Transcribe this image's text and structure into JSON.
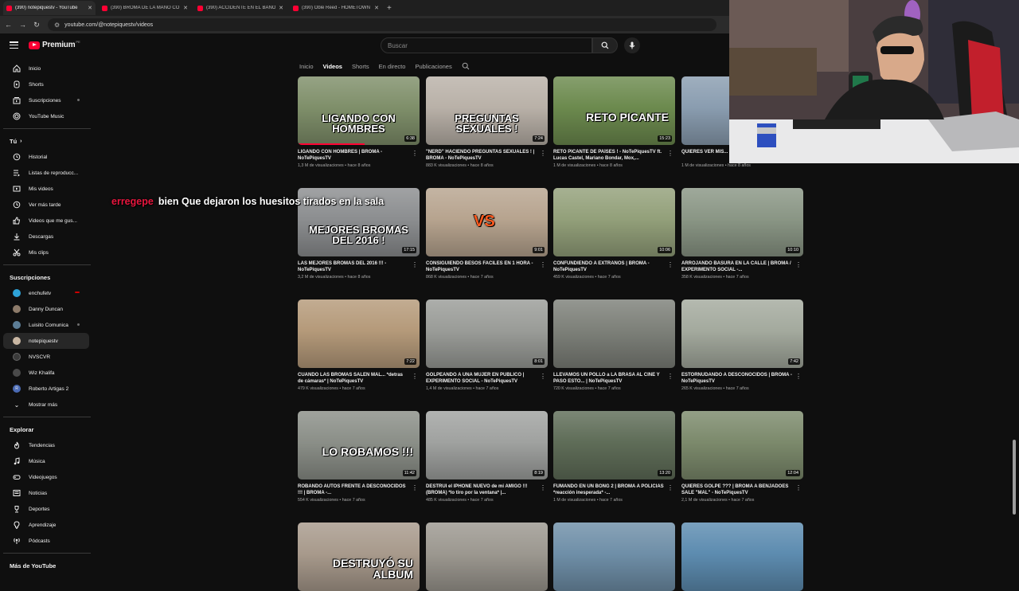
{
  "browser": {
    "tabs": [
      {
        "title": "(390) notepiquestv - YouTube",
        "active": true
      },
      {
        "title": "(390) BROMA DE LA MANO CO",
        "active": false
      },
      {
        "title": "(390) ACCIDENTE EN EL BAÑO",
        "active": false
      },
      {
        "title": "(390) Oblé Reed - HOMETOWN",
        "active": false
      }
    ],
    "url": "youtube.com/@notepiquestv/videos"
  },
  "masthead": {
    "logo_text": "Premium",
    "logo_badge": "PE",
    "search_placeholder": "Buscar"
  },
  "sidebar": {
    "main": [
      "Inicio",
      "Shorts",
      "Suscripciones",
      "YouTube Music"
    ],
    "you_header": "Tú",
    "you_items": [
      "Historial",
      "Listas de reproducc...",
      "Mis videos",
      "Ver más tarde",
      "Videos que me gus...",
      "Descargas",
      "Mis clips"
    ],
    "subs_header": "Suscripciones",
    "subs": [
      {
        "name": "enchufetv",
        "avatar": "#2ea3d8"
      },
      {
        "name": "Danny Duncan",
        "avatar": "#8d7b6a"
      },
      {
        "name": "Luisito Comunica",
        "avatar": "#5c7d96"
      },
      {
        "name": "notepiquestv",
        "avatar": "#c9b7a3"
      },
      {
        "name": "NVSCVR",
        "avatar": "#3a3a3a"
      },
      {
        "name": "Wiz Khalifa",
        "avatar": "#4a4a4a"
      },
      {
        "name": "Roberto Artigas 2",
        "avatar": "#4b6bb5",
        "letter": "R"
      }
    ],
    "show_more": "Mostrar más",
    "explore_header": "Explorar",
    "explore": [
      "Tendencias",
      "Música",
      "Videojuegos",
      "Noticias",
      "Deportes",
      "Aprendizaje",
      "Pódcasts"
    ],
    "more_header": "Más de YouTube"
  },
  "channel_tabs": [
    "Inicio",
    "Videos",
    "Shorts",
    "En directo",
    "Publicaciones"
  ],
  "videos": [
    {
      "title": "LIGANDO CON HOMBRES | BROMA - NoTePiquesTV",
      "views": "1,3 M de visualizaciones",
      "age": "hace 8 años",
      "duration": "6:38",
      "overlay": "LIGANDO CON HOMBRES",
      "progress": 0.55,
      "bg": "#7f8f6a"
    },
    {
      "title": "\"NERD\" HACIENDO PREGUNTAS SEXUALES ! | BROMA - NoTePiquesTV",
      "views": "883 K visualizaciones",
      "age": "hace 8 años",
      "duration": "7:24",
      "overlay": "PREGUNTAS SEXUALES !",
      "progress": 0,
      "bg": "#b9b1a8"
    },
    {
      "title": "RETO PICANTE DE PAÍSES ! - NoTePiquesTV ft. Lucas Castel, Mariano Bondar, Mox,...",
      "views": "1 M de visualizaciones",
      "age": "hace 8 años",
      "duration": "15:23",
      "overlay": "RETO PICANTE",
      "progress": 0,
      "bg": "#6c8a4e"
    },
    {
      "title": "QUIERES VER MIS... PESADA - NoTePiquesTV",
      "views": "1 M de visualizaciones",
      "age": "hace 8 años",
      "duration": "",
      "overlay": "",
      "progress": 0,
      "bg": "#8a9db0"
    },
    {
      "title": "LAS MEJORES BROMAS DEL 2016 !!! - NoTePiquesTV",
      "views": "3,2 M de visualizaciones",
      "age": "hace 8 años",
      "duration": "17:15",
      "overlay": "MEJORES BROMAS DEL 2016 !",
      "progress": 0,
      "bg": "#8c8e90"
    },
    {
      "title": "CONSIGUIENDO BESOS FACILES EN 1 HORA - NoTePiquesTV",
      "views": "868 K visualizaciones",
      "age": "hace 7 años",
      "duration": "9:01",
      "overlay": "VS",
      "progress": 0,
      "bg": "#b7a48f"
    },
    {
      "title": "CONFUNDIENDO A EXTRAÑOS | BROMA - NoTePiquesTV",
      "views": "459 K visualizaciones",
      "age": "hace 7 años",
      "duration": "10:06",
      "overlay": "",
      "progress": 0,
      "bg": "#93a07a"
    },
    {
      "title": "ARROJANDO BASURA EN LA CALLE | BROMA / EXPERIMENTO SOCIAL -...",
      "views": "358 K visualizaciones",
      "age": "hace 7 años",
      "duration": "10:10",
      "overlay": "",
      "progress": 0,
      "bg": "#8a9685"
    },
    {
      "title": "CUANDO LAS BROMAS SALEN MAL... *detras de cámaras* | NoTePiquesTV",
      "views": "479 K visualizaciones",
      "age": "hace 7 años",
      "duration": "7:22",
      "overlay": "",
      "progress": 0,
      "bg": "#b59a7a"
    },
    {
      "title": "GOLPEANDO A UNA MUJER EN PUBLICO | EXPERIMENTO SOCIAL - NoTePiquesTV",
      "views": "1,4 M de visualizaciones",
      "age": "hace 7 años",
      "duration": "8:01",
      "overlay": "",
      "progress": 0,
      "bg": "#9a9c98"
    },
    {
      "title": "LLEVAMOS UN POLLO a LA BRASA AL CINE Y PASO ESTO... | NoTePiquesTV",
      "views": "720 K visualizaciones",
      "age": "hace 7 años",
      "duration": "",
      "overlay": "",
      "progress": 0,
      "bg": "#7d8079"
    },
    {
      "title": "ESTORNUDANDO A DESCONOCIDOS | BROMA - NoTePiquesTV",
      "views": "265 K visualizaciones",
      "age": "hace 7 años",
      "duration": "7:42",
      "overlay": "",
      "progress": 0,
      "bg": "#a4aa9e"
    },
    {
      "title": "ROBANDO AUTOS FRENTE A DESCONOCIDOS !!! | BROMA -...",
      "views": "554 K visualizaciones",
      "age": "hace 7 años",
      "duration": "11:42",
      "overlay": "LO ROBAMOS !!!",
      "progress": 0,
      "bg": "#8b8f88"
    },
    {
      "title": "DESTRUI el IPHONE NUEVO de mi AMIGO !!! (BROMA) *lo tiro por la ventana* |...",
      "views": "485 K visualizaciones",
      "age": "hace 7 años",
      "duration": "8:19",
      "overlay": "",
      "progress": 0,
      "bg": "#a0a2a0"
    },
    {
      "title": "FUMANDO EN UN BONG 2 | BROMA A POLICIAS *reacción inesperada* -...",
      "views": "1 M de visualizaciones",
      "age": "hace 7 años",
      "duration": "13:20",
      "overlay": "",
      "progress": 0,
      "bg": "#5f6d58"
    },
    {
      "title": "QUIERES GOLPE ??? | BROMA A BENJADOES SALE \"MAL\" - NoTePiquesTV",
      "views": "2,1 M de visualizaciones",
      "age": "hace 7 años",
      "duration": "12:04",
      "overlay": "",
      "progress": 0,
      "bg": "#7c8a6c"
    },
    {
      "title": "",
      "views": "",
      "age": "",
      "duration": "",
      "overlay": "Destruyó su ALBUM",
      "progress": 0,
      "bg": "#a89a8c"
    },
    {
      "title": "",
      "views": "",
      "age": "",
      "duration": "",
      "overlay": "",
      "progress": 0,
      "bg": "#9c9890"
    },
    {
      "title": "",
      "views": "",
      "age": "",
      "duration": "",
      "overlay": "",
      "progress": 0,
      "bg": "#6f8fa8"
    },
    {
      "title": "",
      "views": "",
      "age": "",
      "duration": "",
      "overlay": "",
      "progress": 0,
      "bg": "#5d8cb0"
    }
  ],
  "caption": {
    "user": "erregepe",
    "text": "bien Que dejaron los huesitos tirados en la sala"
  },
  "colors": {
    "accent": "#ff0033",
    "caption_user": "#e8163e"
  }
}
